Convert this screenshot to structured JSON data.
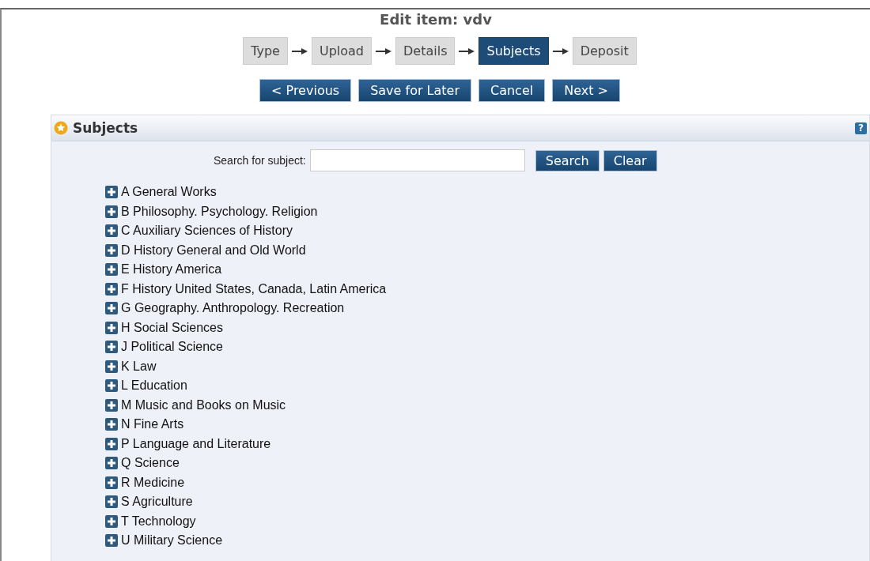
{
  "title": "Edit item: vdv",
  "steps": [
    {
      "label": "Type",
      "selected": false
    },
    {
      "label": "Upload",
      "selected": false
    },
    {
      "label": "Details",
      "selected": false
    },
    {
      "label": "Subjects",
      "selected": true
    },
    {
      "label": "Deposit",
      "selected": false
    }
  ],
  "buttons": [
    "< Previous",
    "Save for Later",
    "Cancel",
    "Next >"
  ],
  "panel": {
    "title": "Subjects",
    "help": "?",
    "search_label": "Search for subject:",
    "search_buttons": [
      "Search",
      "Clear"
    ]
  },
  "subjects": [
    {
      "label": "A General Works",
      "expanded": false
    },
    {
      "label": "B Philosophy. Psychology. Religion",
      "expanded": false
    },
    {
      "label": "C Auxiliary Sciences of History",
      "expanded": false
    },
    {
      "label": "D History General and Old World",
      "expanded": false
    },
    {
      "label": "E History America",
      "expanded": false
    },
    {
      "label": "F History United States, Canada, Latin America",
      "expanded": false
    },
    {
      "label": "G Geography. Anthropology. Recreation",
      "expanded": false
    },
    {
      "label": "H Social Sciences",
      "expanded": false
    },
    {
      "label": "J Political Science",
      "expanded": false
    },
    {
      "label": "K Law",
      "expanded": false
    },
    {
      "label": "L Education",
      "expanded": false
    },
    {
      "label": "M Music and Books on Music",
      "expanded": false
    },
    {
      "label": "N Fine Arts",
      "expanded": false
    },
    {
      "label": "P Language and Literature",
      "expanded": false
    },
    {
      "label": "Q Science",
      "expanded": false
    },
    {
      "label": "R Medicine",
      "expanded": false
    },
    {
      "label": "S Agriculture",
      "expanded": false
    },
    {
      "label": "T Technology",
      "expanded": false
    },
    {
      "label": "U Military Science",
      "expanded": false
    }
  ]
}
